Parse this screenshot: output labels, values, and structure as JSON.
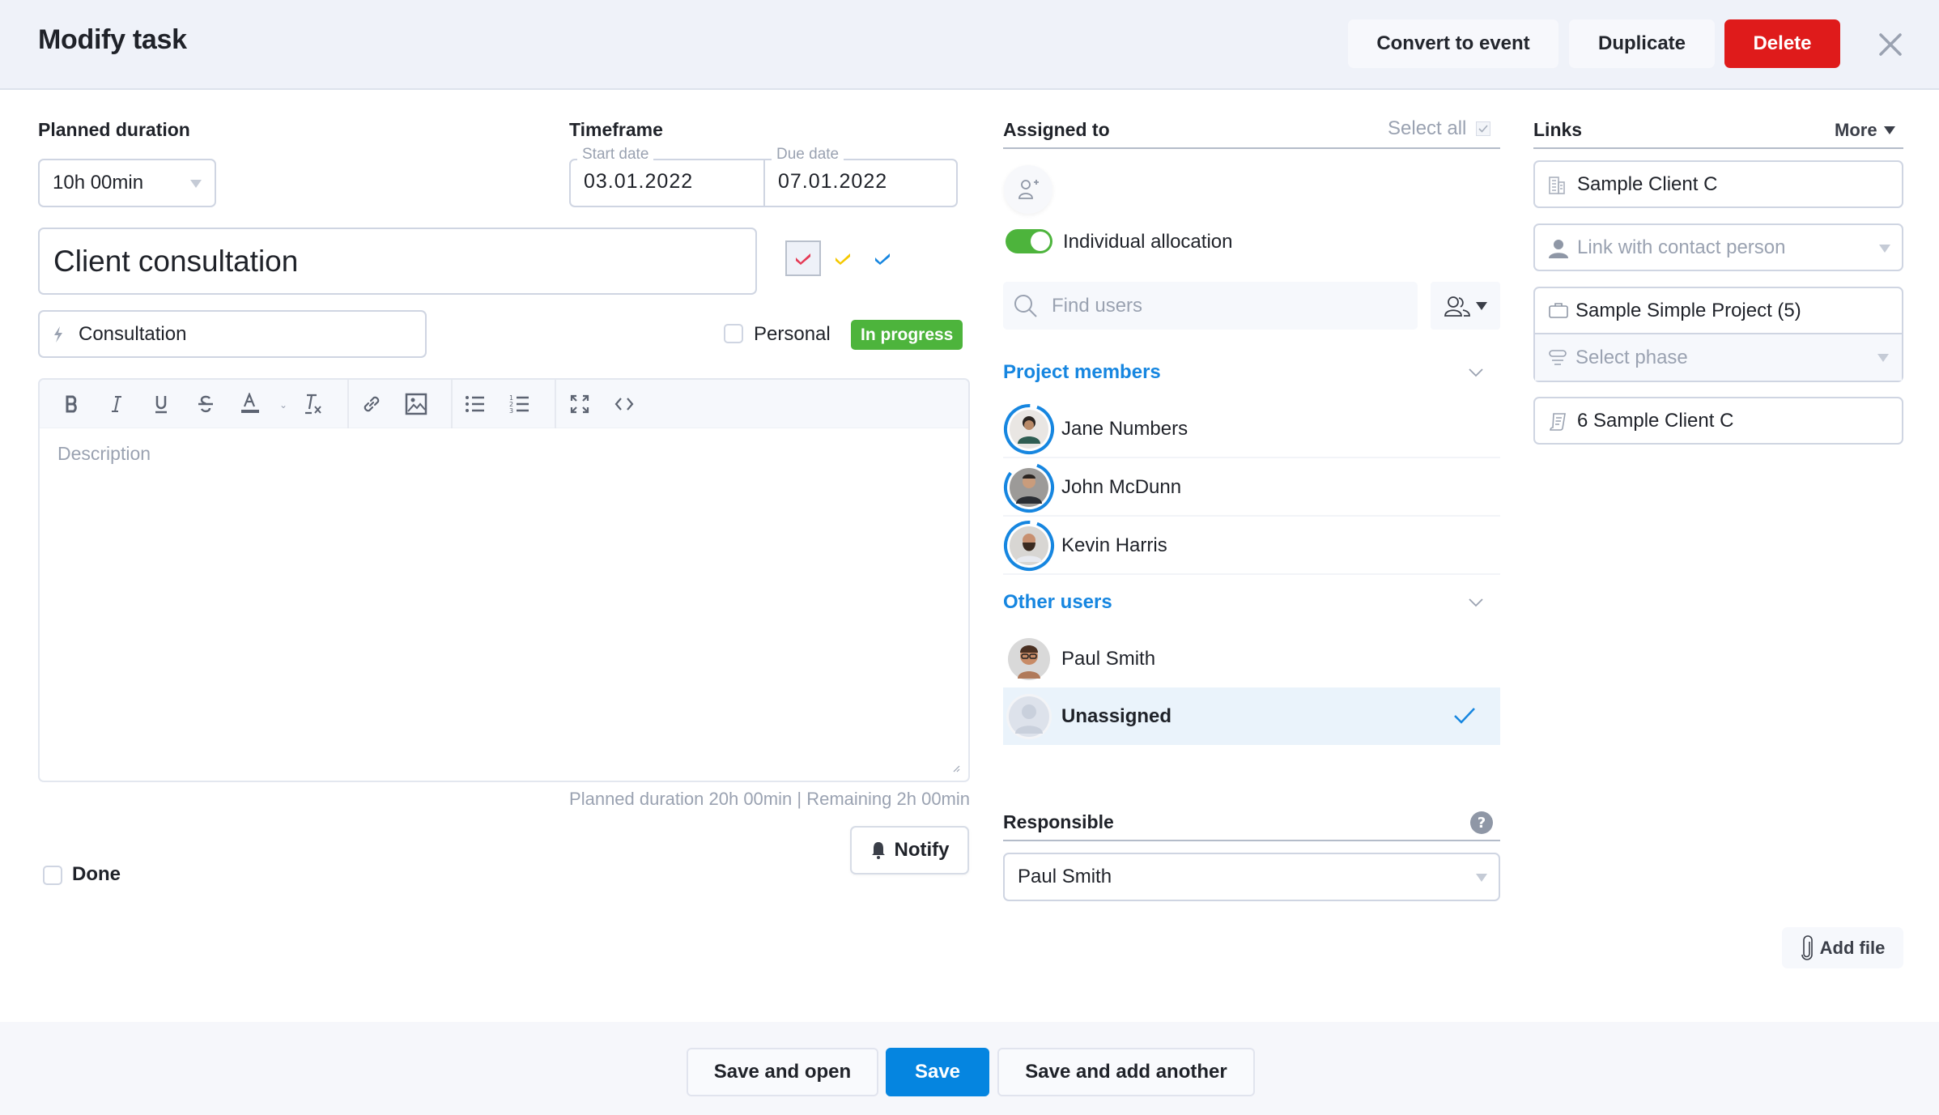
{
  "header": {
    "title": "Modify task",
    "convert_label": "Convert to event",
    "duplicate_label": "Duplicate",
    "delete_label": "Delete",
    "close_icon": "close-icon"
  },
  "planned_duration": {
    "label": "Planned duration",
    "value": "10h 00min"
  },
  "timeframe": {
    "label": "Timeframe",
    "start_label": "Start date",
    "start_value": "03.01.2022",
    "due_label": "Due date",
    "due_value": "07.01.2022"
  },
  "task": {
    "title": "Client consultation",
    "category": "Consultation",
    "category_icon": "lightning-icon",
    "priorities": [
      {
        "name": "high",
        "color": "#e53a55",
        "selected": true
      },
      {
        "name": "medium",
        "color": "#f5c800",
        "selected": false
      },
      {
        "name": "low",
        "color": "#1686e0",
        "selected": false
      }
    ],
    "personal_label": "Personal",
    "personal_checked": false,
    "status": "In progress",
    "status_color": "#4db43c"
  },
  "editor": {
    "placeholder": "Description",
    "toolbar": [
      "bold",
      "italic",
      "underline",
      "strikethrough",
      "text-color",
      "clear-format",
      "link",
      "image",
      "bullet-list",
      "numbered-list",
      "fullscreen",
      "source-code"
    ]
  },
  "stats": {
    "planned": "Planned duration 20h 00min",
    "separator": "|",
    "remaining": "Remaining 2h 00min"
  },
  "notify_label": "Notify",
  "done_label": "Done",
  "done_checked": false,
  "assigned": {
    "label": "Assigned to",
    "select_all": "Select all",
    "individual_allocation_label": "Individual allocation",
    "individual_allocation_on": true,
    "search_placeholder": "Find users",
    "project_members_title": "Project members",
    "project_members": [
      {
        "name": "Jane Numbers",
        "workload": 0.95
      },
      {
        "name": "John McDunn",
        "workload": 0.8
      },
      {
        "name": "Kevin Harris",
        "workload": 0.95
      }
    ],
    "other_users_title": "Other users",
    "other_users": [
      {
        "name": "Paul Smith",
        "selected": false
      },
      {
        "name": "Unassigned",
        "selected": true
      }
    ]
  },
  "responsible": {
    "label": "Responsible",
    "value": "Paul Smith"
  },
  "links": {
    "label": "Links",
    "more_label": "More",
    "client": "Sample Client C",
    "contact_placeholder": "Link with contact person",
    "project": "Sample Simple Project (5)",
    "phase_placeholder": "Select phase",
    "order": "6 Sample Client C",
    "add_file_label": "Add file"
  },
  "footer": {
    "save_open_label": "Save and open",
    "save_label": "Save",
    "save_another_label": "Save and add another"
  },
  "colors": {
    "accent": "#0585e0",
    "danger": "#df1b1b",
    "success": "#4db43c"
  }
}
